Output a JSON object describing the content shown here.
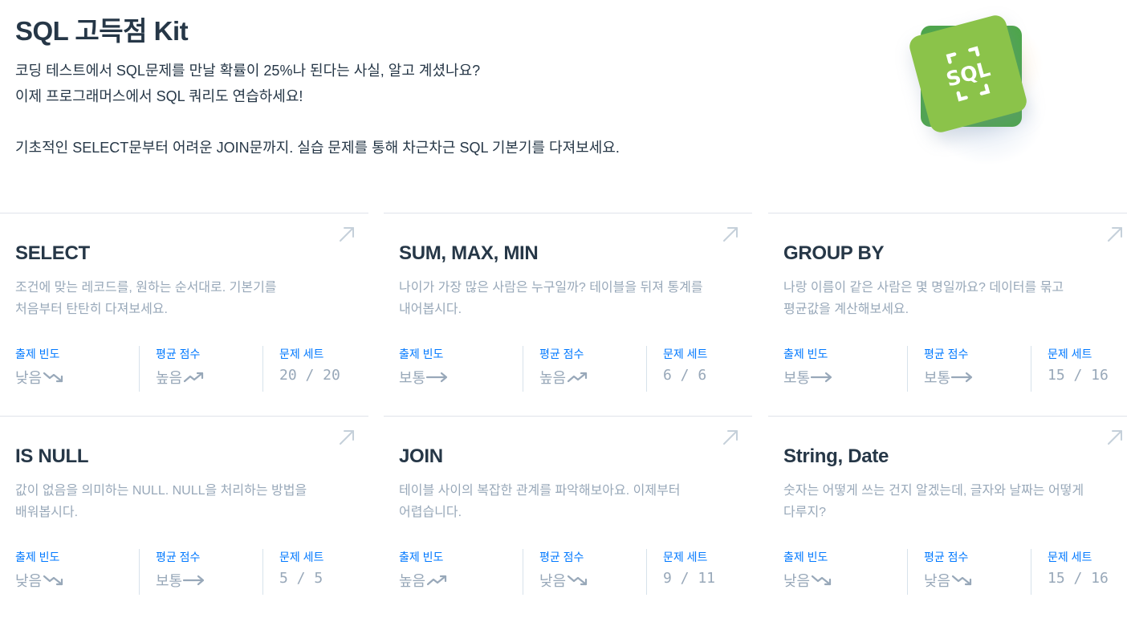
{
  "hero": {
    "title": "SQL 고득점 Kit",
    "line1": "코딩 테스트에서 SQL문제를 만날 확률이 25%나 된다는 사실, 알고 계셨나요?",
    "line2": "이제 프로그래머스에서 SQL 쿼리도 연습하세요!",
    "line3": "기초적인 SELECT문부터 어려운 JOIN문까지. 실습 문제를 통해 차근차근 SQL 기본기를 다져보세요.",
    "logo_icon": "sql-kit-logo-icon",
    "logo_colors": {
      "front": "#8bc34a",
      "back": "#4ea64b"
    }
  },
  "labels": {
    "frequency": "출제 빈도",
    "score": "평균 점수",
    "set": "문제 세트"
  },
  "colors": {
    "accent": "#0078ff",
    "muted": "#98a8b9",
    "title": "#263747"
  },
  "cards": [
    {
      "title": "SELECT",
      "sub1": "조건에 맞는 레코드를, 원하는 순서대로. 기본기를",
      "sub2": "처음부터 탄탄히 다져보세요.",
      "freq": "낮음",
      "freq_trend": "down",
      "score": "높음",
      "score_trend": "up",
      "set": "20 / 20"
    },
    {
      "title": "SUM, MAX, MIN",
      "sub1": "나이가 가장 많은 사람은 누구일까? 테이블을 뒤져 통계를",
      "sub2": "내어봅시다.",
      "freq": "보통",
      "freq_trend": "flat",
      "score": "높음",
      "score_trend": "up",
      "set": "6 / 6"
    },
    {
      "title": "GROUP BY",
      "sub1": "나랑 이름이 같은 사람은 몇 명일까요? 데이터를 묶고",
      "sub2": "평균값을 계산해보세요.",
      "freq": "보통",
      "freq_trend": "flat",
      "score": "보통",
      "score_trend": "flat",
      "set": "15 / 16"
    },
    {
      "title": "IS NULL",
      "sub1": "값이 없음을 의미하는 NULL. NULL을 처리하는 방법을",
      "sub2": "배워봅시다.",
      "freq": "낮음",
      "freq_trend": "down",
      "score": "보통",
      "score_trend": "flat",
      "set": "5 / 5"
    },
    {
      "title": "JOIN",
      "sub1": "테이블 사이의 복잡한 관계를 파악해보아요. 이제부터",
      "sub2": "어렵습니다.",
      "freq": "높음",
      "freq_trend": "up",
      "score": "낮음",
      "score_trend": "down",
      "set": "9 / 11"
    },
    {
      "title": "String, Date",
      "sub1": "숫자는 어떻게 쓰는 건지 알겠는데, 글자와 날짜는 어떻게",
      "sub2": "다루지?",
      "freq": "낮음",
      "freq_trend": "down",
      "score": "낮음",
      "score_trend": "down",
      "set": "15 / 16"
    }
  ]
}
